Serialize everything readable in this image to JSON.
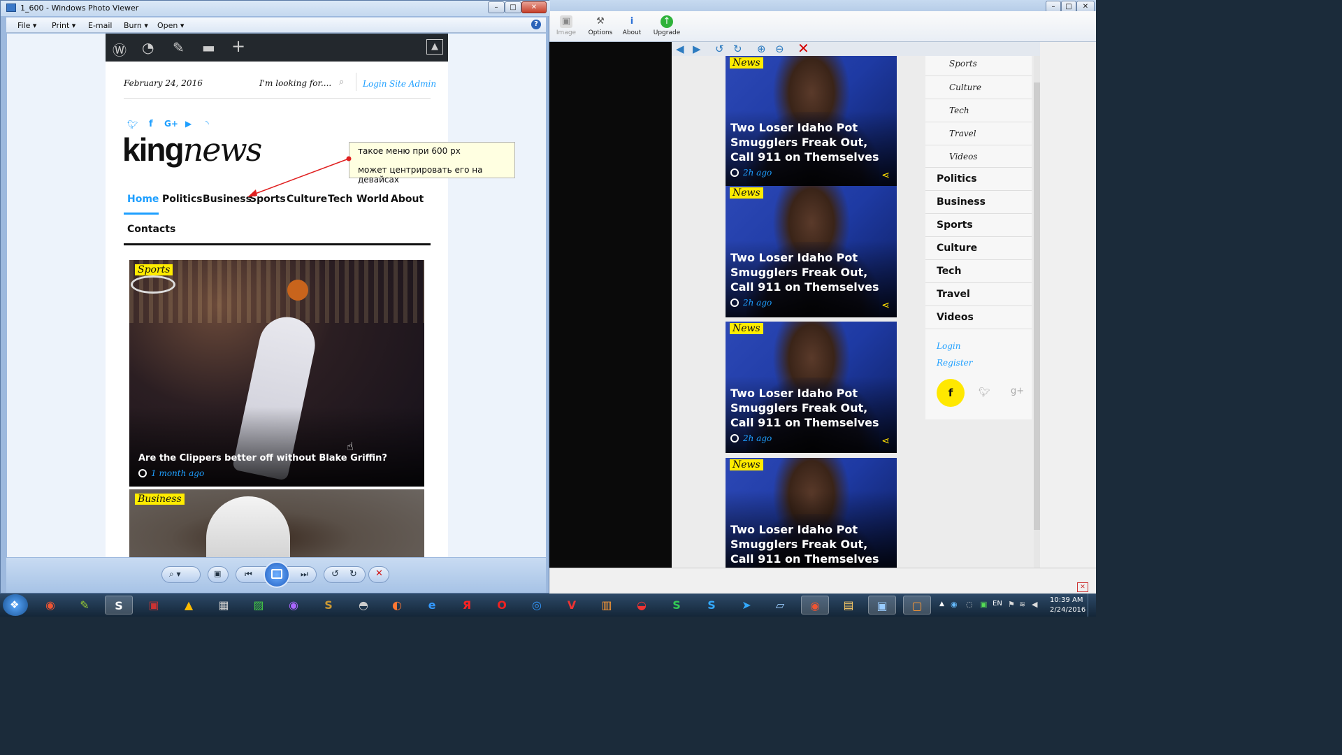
{
  "photo_viewer": {
    "title": "1_600 - Windows Photo Viewer",
    "menu": [
      "File",
      "Print",
      "E-mail",
      "Burn",
      "Open"
    ],
    "help_icon": "help-icon"
  },
  "site": {
    "date": "February 24, 2016",
    "search_placeholder": "I'm looking for....",
    "login": "Login",
    "site_admin": "Site Admin",
    "logo_bold": "king",
    "logo_italic": "news",
    "nav": [
      "Home",
      "Politics",
      "Business",
      "Sports",
      "Culture",
      "Tech",
      "World",
      "About",
      "Contacts"
    ],
    "active_nav": "Home",
    "post1": {
      "tag": "Sports",
      "title": "Are the Clippers better off without Blake Griffin?",
      "time": "1 month ago"
    },
    "post2": {
      "tag": "Business"
    }
  },
  "annotation": {
    "line1": "такое меню при 600 px",
    "line2": "может центрировать его на девайсах"
  },
  "background_app": {
    "ribbon": [
      "Image",
      "Options",
      "About",
      "Upgrade"
    ],
    "cards": [
      {
        "tag": "News",
        "title": "Two Loser Idaho Pot Smugglers Freak Out, Call 911 on Themselves",
        "time": "2h ago"
      },
      {
        "tag": "News",
        "title": "Two Loser Idaho Pot Smugglers Freak Out, Call 911 on Themselves",
        "time": "2h ago"
      },
      {
        "tag": "News",
        "title": "Two Loser Idaho Pot Smugglers Freak Out, Call 911 on Themselves",
        "time": "2h ago"
      },
      {
        "tag": "News",
        "title": "Two Loser Idaho Pot Smugglers Freak Out, Call 911 on Themselves"
      }
    ],
    "sidebar_sub": [
      "Sports",
      "Culture",
      "Tech",
      "Travel",
      "Videos"
    ],
    "sidebar_main": [
      "Politics",
      "Business",
      "Sports",
      "Culture",
      "Tech",
      "Travel",
      "Videos"
    ],
    "sidebar_login": "Login",
    "sidebar_register": "Register",
    "social_fb": "f"
  },
  "taskbar": {
    "time": "10:39 AM",
    "date": "2/24/2016",
    "lang": "EN"
  },
  "colors": {
    "accent": "#1e9fff",
    "tag_yellow": "#ffec00",
    "admin_bar": "#23282d"
  }
}
